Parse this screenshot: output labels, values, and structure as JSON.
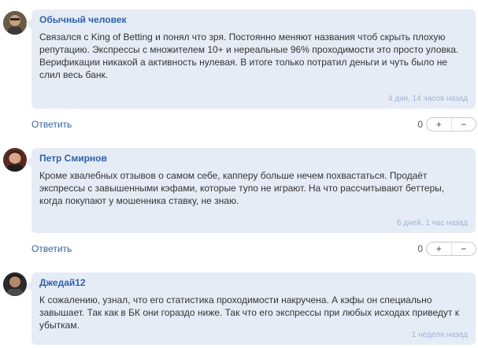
{
  "comments": [
    {
      "author": "Обычный человек",
      "text": "Связался с King of Betting и понял что зря. Постоянно меняют названия чтоб скрыть плохую репутацию. Экспрессы с множителем 10+ и нереальные 96% проходимости это просто уловка. Верификации никакой а активность нулевая. В итоге только потратил деньги и чуть было не слил весь банк.",
      "time": "4 дня, 14 часов назад",
      "reply_label": "Ответить",
      "score": "0",
      "plus_label": "+",
      "minus_label": "−"
    },
    {
      "author": "Петр Смирнов",
      "text": "Кроме хвалебных отзывов о самом себе, капперу больше нечем похвастаться. Продаёт экспрессы с завышенными кэфами, которые тупо не играют. На что рассчитывают беттеры, когда покупают у мошенника ставку, не знаю.",
      "time": "6 дней, 1 час назад",
      "reply_label": "Ответить",
      "score": "0",
      "plus_label": "+",
      "minus_label": "−"
    },
    {
      "author": "Джедай12",
      "text": "К сожалению, узнал, что его статистика проходимости накручена. А кэфы он специально завышает. Так как в БК они гораздо ниже. Так что его экспрессы при любых исходах приведут к убыткам.",
      "time": "1 неделя назад"
    }
  ]
}
